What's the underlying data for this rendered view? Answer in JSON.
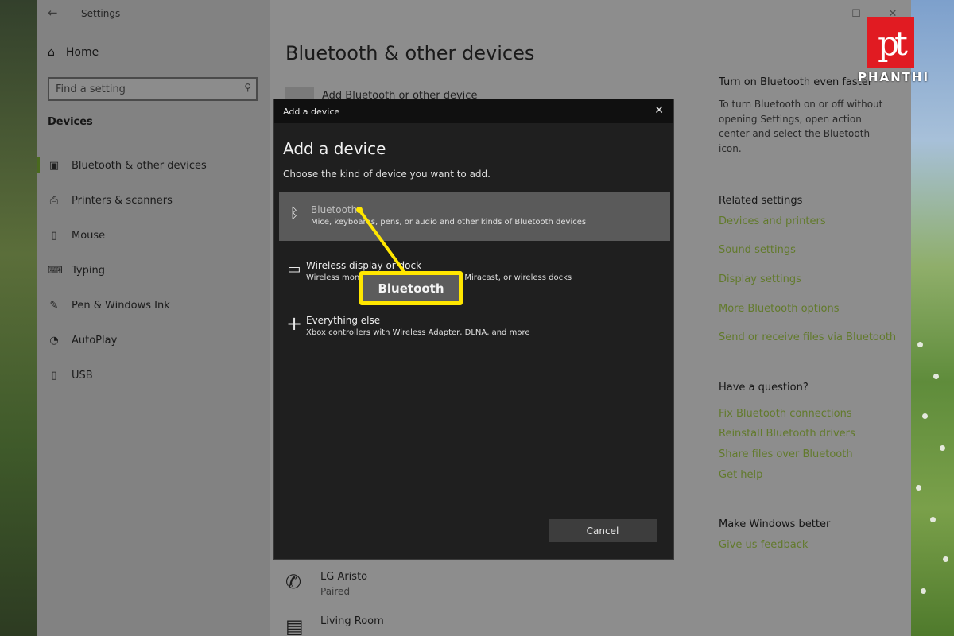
{
  "window": {
    "title": "Settings",
    "controls": {
      "minimize": "—",
      "maximize": "☐",
      "close": "✕"
    }
  },
  "sidebar": {
    "home": "Home",
    "search_placeholder": "Find a setting",
    "section": "Devices",
    "items": [
      {
        "label": "Bluetooth & other devices",
        "icon": "bluetooth-devices-icon",
        "active": true
      },
      {
        "label": "Printers & scanners",
        "icon": "printer-icon"
      },
      {
        "label": "Mouse",
        "icon": "mouse-icon"
      },
      {
        "label": "Typing",
        "icon": "keyboard-icon"
      },
      {
        "label": "Pen & Windows Ink",
        "icon": "pen-icon"
      },
      {
        "label": "AutoPlay",
        "icon": "autoplay-icon"
      },
      {
        "label": "USB",
        "icon": "usb-icon"
      }
    ]
  },
  "main": {
    "title": "Bluetooth & other devices",
    "add_device": "Add Bluetooth or other device",
    "devices": [
      {
        "name": "LG Aristo",
        "status": "Paired",
        "icon": "phone-icon"
      },
      {
        "name": "Living Room",
        "status": "",
        "icon": "media-device-icon"
      }
    ]
  },
  "right_panel": {
    "tip_heading": "Turn on Bluetooth even faster",
    "tip_text": "To turn Bluetooth on or off without opening Settings, open action center and select the Bluetooth icon.",
    "related_heading": "Related settings",
    "related_links": [
      "Devices and printers",
      "Sound settings",
      "Display settings",
      "More Bluetooth options",
      "Send or receive files via Bluetooth"
    ],
    "question_heading": "Have a question?",
    "question_links": [
      "Fix Bluetooth connections",
      "Reinstall Bluetooth drivers",
      "Share files over Bluetooth",
      "Get help"
    ],
    "better_heading": "Make Windows better",
    "feedback_link": "Give us feedback"
  },
  "dialog": {
    "titlebar": "Add a device",
    "heading": "Add a device",
    "subtitle": "Choose the kind of device you want to add.",
    "options": [
      {
        "title": "Bluetooth",
        "desc": "Mice, keyboards, pens, or audio and other kinds of Bluetooth devices",
        "icon": "bluetooth-icon",
        "selected": true
      },
      {
        "title": "Wireless display or dock",
        "desc": "Wireless monitors, TVs, or PCs that use Miracast, or wireless docks",
        "icon": "monitor-icon"
      },
      {
        "title": "Everything else",
        "desc": "Xbox controllers with Wireless Adapter, DLNA, and more",
        "icon": "plus-icon"
      }
    ],
    "cancel": "Cancel"
  },
  "callout": {
    "label": "Bluetooth",
    "color": "#ffe600"
  },
  "logo": {
    "text": "PHANTHI",
    "mark": "pt",
    "color": "#e11b22"
  }
}
